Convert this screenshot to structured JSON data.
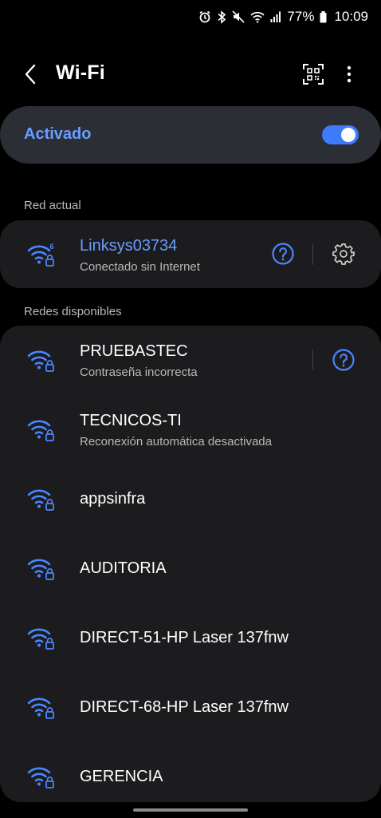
{
  "status_bar": {
    "battery": "77%",
    "time": "10:09"
  },
  "header": {
    "title": "Wi-Fi"
  },
  "wifi_toggle": {
    "label": "Activado",
    "enabled": true
  },
  "current_network": {
    "section_label": "Red actual",
    "name": "Linksys03734",
    "status": "Conectado sin Internet"
  },
  "available": {
    "section_label": "Redes disponibles",
    "networks": [
      {
        "name": "PRUEBASTEC",
        "status": "Contraseña incorrecta"
      },
      {
        "name": "TECNICOS-TI",
        "status": "Reconexión automática desactivada"
      },
      {
        "name": "appsinfra",
        "status": ""
      },
      {
        "name": "AUDITORIA",
        "status": ""
      },
      {
        "name": "DIRECT-51-HP Laser 137fnw",
        "status": ""
      },
      {
        "name": "DIRECT-68-HP Laser 137fnw",
        "status": ""
      },
      {
        "name": "GERENCIA",
        "status": ""
      }
    ]
  },
  "colors": {
    "accent": "#3e7bfa",
    "accent_text": "#6a9cff",
    "card": "#1c1c1f",
    "toggle_card": "#2b2e35"
  }
}
